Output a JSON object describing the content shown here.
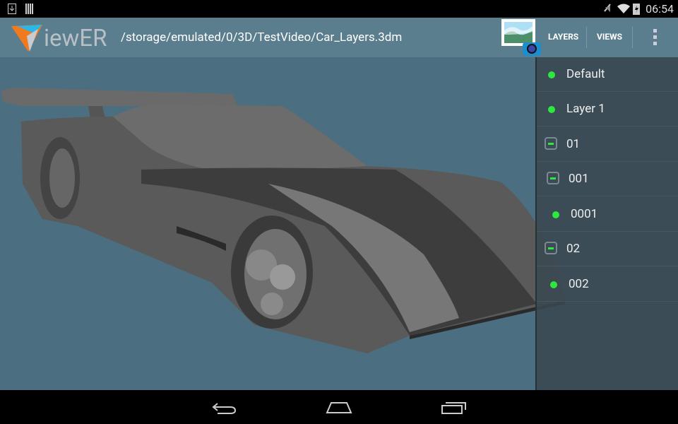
{
  "status_bar": {
    "time": "06:54",
    "icons": [
      "download-icon",
      "barcode-icon",
      "mute-icon",
      "wifi-icon",
      "battery-charging-icon"
    ]
  },
  "action_bar": {
    "app_name": "iewER",
    "logo_letter": "V",
    "file_path": "/storage/emulated/0/3D/TestVideo/Car_Layers.3dm",
    "screenshot_button": "camera-screenshot-icon",
    "layers_label": "LAYERS",
    "views_label": "VIEWS",
    "overflow": "overflow-menu-icon"
  },
  "layers": [
    {
      "label": "Default",
      "type": "dot",
      "depth": 0
    },
    {
      "label": "Layer 1",
      "type": "dot",
      "depth": 0
    },
    {
      "label": "01",
      "type": "collapse",
      "depth": 0
    },
    {
      "label": "001",
      "type": "collapse",
      "depth": 1
    },
    {
      "label": "0001",
      "type": "dot",
      "depth": 2
    },
    {
      "label": "02",
      "type": "collapse",
      "depth": 0
    },
    {
      "label": "002",
      "type": "dot",
      "depth": 1
    }
  ],
  "colors": {
    "action_bar": "#5b7e8e",
    "viewport": "#4b6f80",
    "layer_on": "#2ee83f",
    "panel": "#3a4850"
  },
  "nav_bar": {
    "icons": [
      "back-icon",
      "home-icon",
      "recents-icon"
    ]
  }
}
